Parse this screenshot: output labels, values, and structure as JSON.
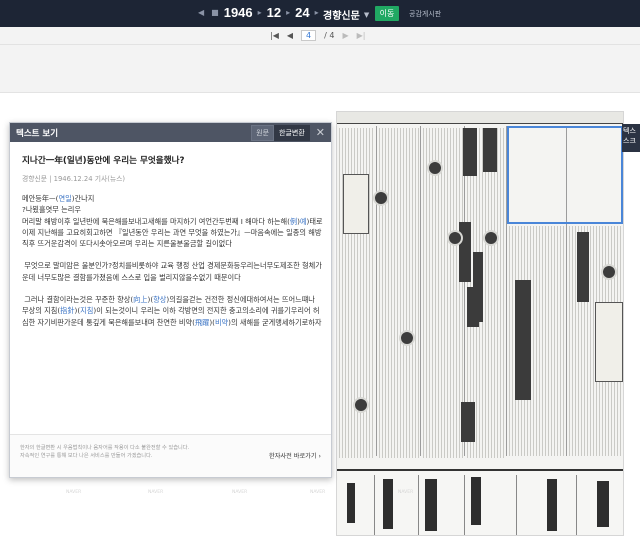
{
  "date": {
    "year": "1946",
    "month": "12",
    "day": "24"
  },
  "newspaper_name": "경향신문",
  "go_button": "이동",
  "public_board": "공감게시판",
  "pager": {
    "current": "4",
    "total": "/ 4"
  },
  "side_tab": "텍스\n스크",
  "panel": {
    "title": "텍스트 보기",
    "mode_original": "원문",
    "mode_converted": "한글변환",
    "article_title": "지나간一年(일년)동안에 우리는 무엇을했나?",
    "article_meta": "경향신문 | 1946.12.24 기사(뉴스)",
    "paragraphs": [
      {
        "segments": [
          [
            "t",
            "메안등年ㅡ("
          ],
          [
            "h",
            "연일"
          ],
          [
            "t",
            ")간나지\n?나뵜흘엿무 는리우\n머리말 해방이후 일년반에 묵은해를보내고새해를 마지하기 여언간두번째 I 해마다 하는해("
          ],
          [
            "h",
            "例"
          ],
          [
            "t",
            ")"
          ],
          [
            "h",
            "예"
          ],
          [
            "t",
            ")태로 이제 지난해를 고요히회고하면 『일년동안 우리는 과연 무엇을 하였는가』ㅡ마음속에는 일종의 해방직후 뜨거운감격이 또다시솟아오르며 우리는 지른울분울금할 길이없다"
          ]
        ]
      },
      {
        "segments": [
          [
            "t",
            " 무엇으로 말미암은 울분인가?정치를비롯하야 교육 행정 산업 경제문화등우리는너무도제조한 형체가운데 너무도많은 결함를가졌음에 스스로 입을 벌리지않을수없기 때문이다"
          ]
        ]
      },
      {
        "segments": [
          [
            "t",
            " 그러나 결함이라는것은 꾸준한 향상("
          ],
          [
            "h",
            "向上"
          ],
          [
            "t",
            ")("
          ],
          [
            "h",
            "향상"
          ],
          [
            "t",
            ")의길을걷는 건전한 정신에대하여서는 뜨어느떄나 무상의 지침("
          ],
          [
            "h",
            "指針"
          ],
          [
            "t",
            ")("
          ],
          [
            "h",
            "지침"
          ],
          [
            "t",
            ")이 되는것이니 우리는 이하 각방면의 전지한 충고의소리에 귀를기우리어 허심한 자기비판가운데 통깊게 묵은해를보내며 찬연한 비약("
          ],
          [
            "h",
            "飛躍"
          ],
          [
            "t",
            ")("
          ],
          [
            "h",
            "비약"
          ],
          [
            "t",
            ")의 새해를 굳게맹세하기로하자"
          ]
        ]
      }
    ],
    "footer_note": "한자의 한글변환 시 우음법칙이나 음자어를 작용이 다소 불완전할 수 있습니다.\n자속적인 연구를 통해 보다 나은 서비스를 만들어 가겠습니다.",
    "footer_link": "한자사전 바로가기 ›"
  },
  "colors": {
    "topbar": "#1d2535",
    "go_button": "#20a863",
    "panel_header": "#4e5564",
    "highlight": "#3a73c4",
    "selection": "#4a86d8"
  }
}
